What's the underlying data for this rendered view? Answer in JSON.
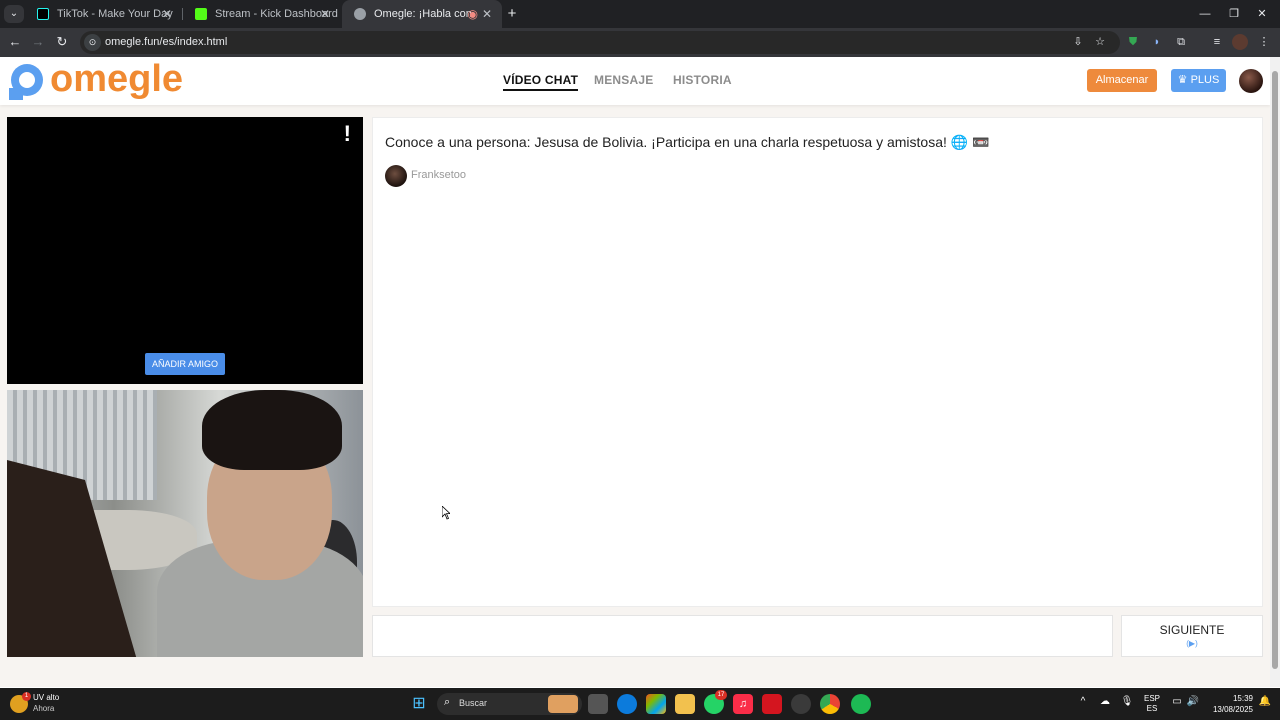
{
  "browser": {
    "tabs": [
      {
        "title": "TikTok - Make Your Day",
        "active": false
      },
      {
        "title": "Stream - Kick Dashboard",
        "active": false
      },
      {
        "title": "Omegle: ¡Habla con Descon",
        "active": true
      }
    ],
    "url": "omegle.fun/es/index.html"
  },
  "header": {
    "logo_text": "omegle",
    "nav": [
      "VÍDEO CHAT",
      "MENSAJE",
      "HISTORIA"
    ],
    "store_label": "Almacenar",
    "plus_label": "♛ PLUS"
  },
  "video": {
    "report_label": "!",
    "add_friend_label": "AÑADIR AMIGO"
  },
  "chat": {
    "intro_message": "Conoce a una persona: Jesusa de Bolivia. ¡Participa en una charla respetuosa y amistosa! 🌐 📼",
    "partner_name": "Franksetoo",
    "next_label": "SIGUIENTE",
    "next_hint": "(▶)"
  },
  "taskbar": {
    "weather_title": "UV alto",
    "weather_sub": "Ahora",
    "weather_badge": "1",
    "search_label": "Buscar",
    "whatsapp_badge": "17",
    "lang_top": "ESP",
    "lang_bottom": "ES",
    "time": "15:39",
    "date": "13/08/2025"
  },
  "colors": {
    "brand_orange": "#f08a32",
    "brand_blue": "#5b9ff0",
    "store_orange": "#ee8a3c"
  }
}
